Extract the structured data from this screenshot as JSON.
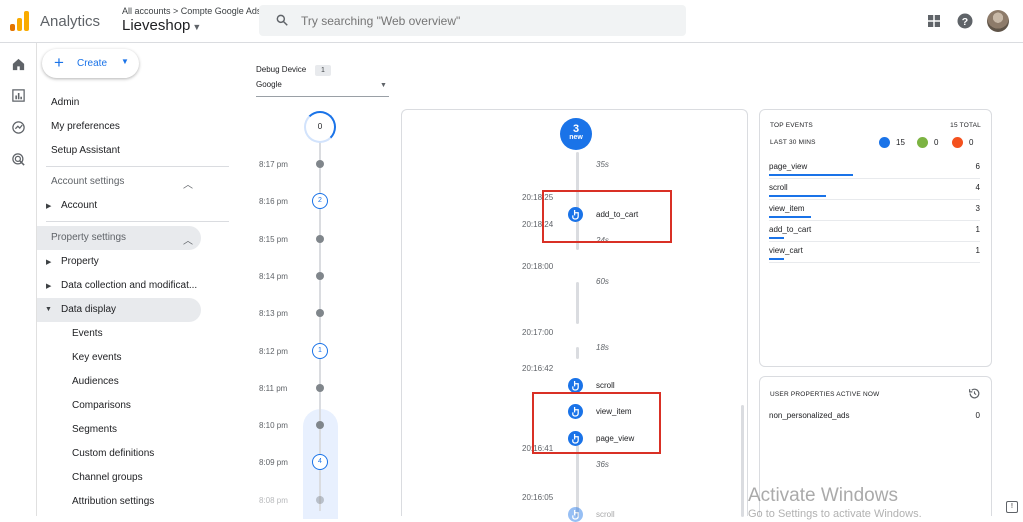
{
  "header": {
    "brand": "Analytics",
    "breadcrumb": "All accounts > Compte Google Ads",
    "property": "Lieveshop",
    "search_placeholder": "Try searching \"Web overview\""
  },
  "sidebar": {
    "create_label": "Create",
    "top_items": [
      "Admin",
      "My preferences",
      "Setup Assistant"
    ],
    "account_settings": {
      "label": "Account settings",
      "items": [
        "Account"
      ]
    },
    "property_settings": {
      "label": "Property settings",
      "items": [
        "Property",
        "Data collection and modificat...",
        "Data display"
      ],
      "data_display_items": [
        "Events",
        "Key events",
        "Audiences",
        "Comparisons",
        "Segments",
        "Custom definitions",
        "Channel groups",
        "Attribution settings"
      ]
    }
  },
  "debug": {
    "label": "Debug Device",
    "count": "1",
    "device": "Google"
  },
  "timeline": {
    "top_count": "0",
    "ticks": [
      {
        "time": "8:17 pm",
        "count": ""
      },
      {
        "time": "8:16 pm",
        "count": "2"
      },
      {
        "time": "8:15 pm",
        "count": ""
      },
      {
        "time": "8:14 pm",
        "count": ""
      },
      {
        "time": "8:13 pm",
        "count": ""
      },
      {
        "time": "8:12 pm",
        "count": "1"
      },
      {
        "time": "8:11 pm",
        "count": ""
      },
      {
        "time": "8:10 pm",
        "count": ""
      },
      {
        "time": "8:09 pm",
        "count": "4"
      },
      {
        "time": "8:08 pm",
        "count": ""
      }
    ]
  },
  "stream": {
    "new_count": "3",
    "new_label": "new",
    "durations": [
      "35s",
      "24s",
      "60s",
      "18s",
      "36s"
    ],
    "times": [
      "20:18:25",
      "20:18:24",
      "20:18:00",
      "20:17:00",
      "20:16:42",
      "20:16:41",
      "20:16:05"
    ],
    "events": [
      "add_to_cart",
      "scroll",
      "view_item",
      "page_view",
      "scroll"
    ]
  },
  "top_events": {
    "title": "TOP EVENTS",
    "total": "15 TOTAL",
    "subtitle": "LAST 30 MINS",
    "counts": {
      "blue": "15",
      "green": "0",
      "orange": "0"
    },
    "rows": [
      {
        "name": "page_view",
        "value": "6",
        "share": 0.4
      },
      {
        "name": "scroll",
        "value": "4",
        "share": 0.27
      },
      {
        "name": "view_item",
        "value": "3",
        "share": 0.2
      },
      {
        "name": "add_to_cart",
        "value": "1",
        "share": 0.07
      },
      {
        "name": "view_cart",
        "value": "1",
        "share": 0.07
      }
    ]
  },
  "user_properties": {
    "title": "USER PROPERTIES ACTIVE NOW",
    "rows": [
      {
        "name": "non_personalized_ads",
        "value": "0"
      }
    ]
  },
  "watermark": {
    "line1": "Activate Windows",
    "line2": "Go to Settings to activate Windows."
  },
  "colors": {
    "accent": "#1a73e8",
    "highlight": "#d93025",
    "green": "#7cb342",
    "orange": "#f4511e"
  }
}
